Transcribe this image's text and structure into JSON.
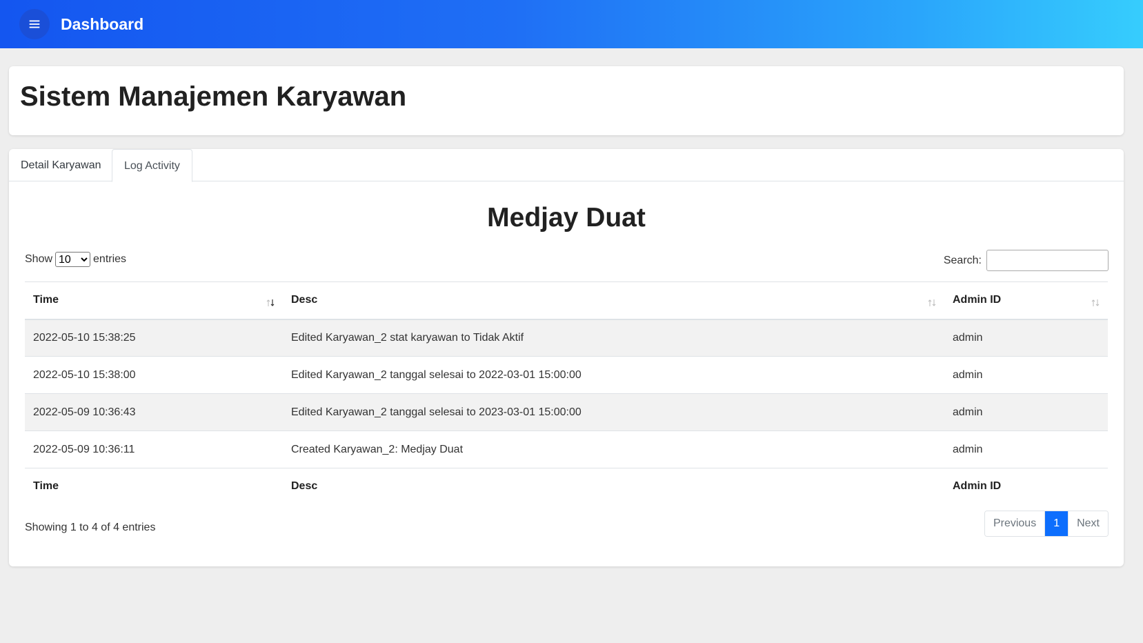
{
  "topbar": {
    "title": "Dashboard",
    "menu_icon": "hamburger-menu-icon"
  },
  "page": {
    "title": "Sistem Manajemen Karyawan"
  },
  "tabs": [
    {
      "label": "Detail Karyawan",
      "active": false
    },
    {
      "label": "Log Activity",
      "active": true
    }
  ],
  "employee_name": "Medjay Duat",
  "length_control": {
    "prefix": "Show",
    "selected": "10",
    "options": [
      "10"
    ],
    "suffix": "entries"
  },
  "search": {
    "label": "Search:",
    "value": ""
  },
  "table": {
    "columns": [
      "Time",
      "Desc",
      "Admin ID"
    ],
    "rows": [
      {
        "time": "2022-05-10 15:38:25",
        "desc": "Edited Karyawan_2 stat karyawan to Tidak Aktif",
        "admin": "admin"
      },
      {
        "time": "2022-05-10 15:38:00",
        "desc": "Edited Karyawan_2 tanggal selesai to 2022-03-01 15:00:00",
        "admin": "admin"
      },
      {
        "time": "2022-05-09 10:36:43",
        "desc": "Edited Karyawan_2 tanggal selesai to 2023-03-01 15:00:00",
        "admin": "admin"
      },
      {
        "time": "2022-05-09 10:36:11",
        "desc": "Created Karyawan_2: Medjay Duat",
        "admin": "admin"
      }
    ]
  },
  "info": "Showing 1 to 4 of 4 entries",
  "pagination": {
    "previous": "Previous",
    "current": "1",
    "next": "Next"
  },
  "colors": {
    "accent": "#0d6efd",
    "topbar_start": "#1456f0",
    "topbar_end": "#36cdfd"
  }
}
